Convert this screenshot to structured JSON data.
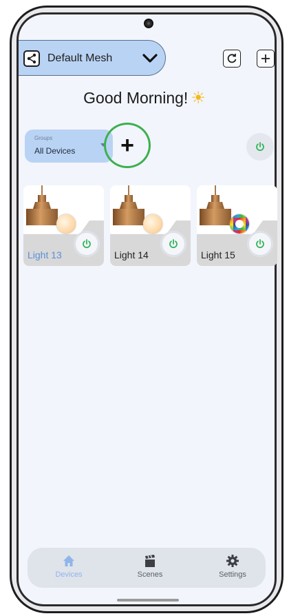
{
  "header": {
    "mesh_name": "Default Mesh",
    "icons": {
      "share": "share-icon",
      "dropdown": "chevron-down-icon",
      "refresh": "refresh-icon",
      "add": "plus-icon"
    }
  },
  "greeting": {
    "text": "Good Morning!",
    "icon": "sun-icon"
  },
  "groups": {
    "caption": "Groups",
    "selected": "All Devices",
    "add_symbol": "+"
  },
  "devices": [
    {
      "label": "Light 13",
      "label_color": "#5b8fd6",
      "indicator": "warm-white"
    },
    {
      "label": "Light 14",
      "label_color": "#222222",
      "indicator": "warm-white"
    },
    {
      "label": "Light 15",
      "label_color": "#222222",
      "indicator": "rgb-color"
    }
  ],
  "nav": {
    "items": [
      {
        "label": "Devices",
        "icon": "home-icon",
        "active": true
      },
      {
        "label": "Scenes",
        "icon": "clapperboard-icon",
        "active": false
      },
      {
        "label": "Settings",
        "icon": "gear-icon",
        "active": false
      }
    ]
  },
  "colors": {
    "accent_blue": "#b9d3f4",
    "power_green": "#2fb35a",
    "highlight_ring": "#3cb04e"
  }
}
